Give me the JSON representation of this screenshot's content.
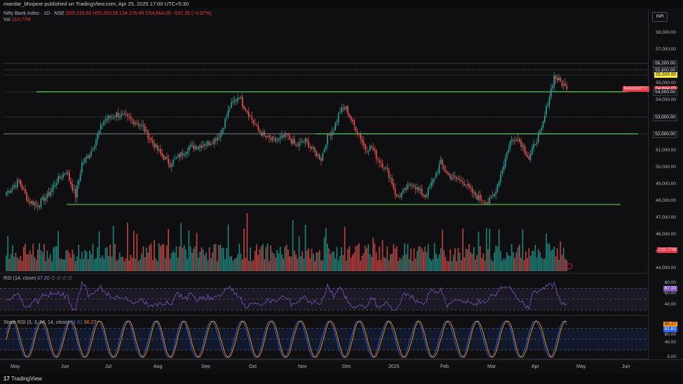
{
  "header": {
    "publish_text": "mandar_bhojane published on TradingView.com, Apr 25, 2025 17:00 UTC+5:30"
  },
  "symbol": {
    "title": "Nifty Bank Index · 1D · NSE",
    "ohlc": "O55,233.55 H55,350.55 L54,176.45 C54,664.05 −537.35 (−0.97%)",
    "volume_label": "Vol",
    "volume_value": "210.77M",
    "ticker_tag": "BANKNIFTY",
    "currency": "INR"
  },
  "price_axis": {
    "ticks": [
      "58,000.00",
      "57,000.00",
      "56,000.00",
      "55,000.00",
      "54,000.00",
      "53,000.00",
      "52,000.00",
      "51,000.00",
      "50,000.00",
      "49,000.00",
      "48,000.00",
      "47,000.00",
      "46,000.00",
      "45,000.00",
      "44,000.00"
    ],
    "levels": [
      {
        "label": "56,200.00",
        "style": "dark",
        "value": 56200
      },
      {
        "label": "55,800.00",
        "style": "dark",
        "value": 55800
      },
      {
        "label": "55,500.00",
        "style": "yellow",
        "value": 55500
      },
      {
        "label": "54,664.05",
        "style": "red",
        "value": 54664.05
      },
      {
        "label": "54,500.00",
        "style": "dark",
        "value": 54500
      },
      {
        "label": "53,000.00",
        "style": "dark",
        "value": 53000
      },
      {
        "label": "52,000.00",
        "style": "dark",
        "value": 52000
      }
    ],
    "volume_tag": "210.77M"
  },
  "rsi": {
    "legend": "RSI (14, close)",
    "value": "67.20",
    "ticks": [
      "80.00",
      "60.00",
      "40.00"
    ],
    "tag": "67.20"
  },
  "stoch": {
    "legend": "Stoch RSI (3, 3, 14, 14, close)",
    "k_value": "81.61",
    "d_value": "90.27",
    "ticks": [
      "80.00",
      "40.00",
      "0.00"
    ],
    "tag_d": "90.27",
    "tag_k": "81.61"
  },
  "time_axis": {
    "labels": [
      "May",
      "Jun",
      "Jul",
      "Aug",
      "Sep",
      "Oct",
      "Nov",
      "Dec",
      "2025",
      "Feb",
      "Mar",
      "Apr",
      "May",
      "Jun"
    ]
  },
  "footer": {
    "brand": "TradingView"
  },
  "colors": {
    "up": "#26a69a",
    "down": "#ef5350",
    "hline_green": "#4caf50",
    "rsi_line": "#7e57c2",
    "stoch_k": "#2962ff",
    "stoch_d": "#ff9800"
  },
  "chart_data": {
    "type": "candlestick",
    "title": "Nifty Bank Index · 1D · NSE",
    "y_range": [
      44000,
      58500
    ],
    "horizontal_levels": [
      56200,
      55800,
      55500,
      54500,
      53000,
      52000
    ],
    "support_zones": [
      54500,
      52000,
      47800
    ],
    "last_close": 54664.05,
    "waypoints": [
      [
        0,
        48500
      ],
      [
        8,
        49200
      ],
      [
        14,
        48000
      ],
      [
        20,
        47800
      ],
      [
        26,
        48300
      ],
      [
        32,
        49200
      ],
      [
        38,
        49800
      ],
      [
        44,
        48300
      ],
      [
        48,
        50200
      ],
      [
        54,
        51000
      ],
      [
        62,
        52800
      ],
      [
        70,
        53200
      ],
      [
        78,
        52900
      ],
      [
        86,
        52500
      ],
      [
        92,
        51600
      ],
      [
        98,
        50800
      ],
      [
        104,
        50200
      ],
      [
        110,
        50700
      ],
      [
        116,
        51200
      ],
      [
        122,
        51300
      ],
      [
        130,
        51500
      ],
      [
        136,
        52000
      ],
      [
        142,
        53600
      ],
      [
        148,
        54300
      ],
      [
        150,
        53800
      ],
      [
        154,
        53200
      ],
      [
        160,
        52200
      ],
      [
        166,
        51700
      ],
      [
        172,
        51600
      ],
      [
        178,
        51900
      ],
      [
        184,
        51300
      ],
      [
        190,
        51600
      ],
      [
        196,
        50900
      ],
      [
        200,
        50500
      ],
      [
        204,
        51800
      ],
      [
        208,
        52300
      ],
      [
        212,
        53400
      ],
      [
        216,
        53500
      ],
      [
        220,
        52600
      ],
      [
        224,
        52000
      ],
      [
        228,
        51100
      ],
      [
        232,
        51200
      ],
      [
        236,
        50500
      ],
      [
        240,
        50100
      ],
      [
        244,
        49400
      ],
      [
        248,
        48200
      ],
      [
        252,
        48500
      ],
      [
        258,
        49100
      ],
      [
        262,
        48600
      ],
      [
        266,
        48300
      ],
      [
        270,
        49000
      ],
      [
        276,
        50300
      ],
      [
        280,
        49600
      ],
      [
        286,
        49300
      ],
      [
        290,
        49200
      ],
      [
        296,
        48500
      ],
      [
        300,
        48200
      ],
      [
        306,
        47900
      ],
      [
        310,
        48400
      ],
      [
        316,
        50200
      ],
      [
        320,
        51500
      ],
      [
        324,
        51800
      ],
      [
        328,
        51300
      ],
      [
        332,
        50500
      ],
      [
        336,
        51500
      ],
      [
        340,
        52200
      ],
      [
        344,
        53900
      ],
      [
        348,
        55400
      ],
      [
        352,
        55100
      ],
      [
        356,
        54664
      ]
    ],
    "rsi_range": [
      20,
      90
    ],
    "stoch_range": [
      0,
      100
    ]
  }
}
